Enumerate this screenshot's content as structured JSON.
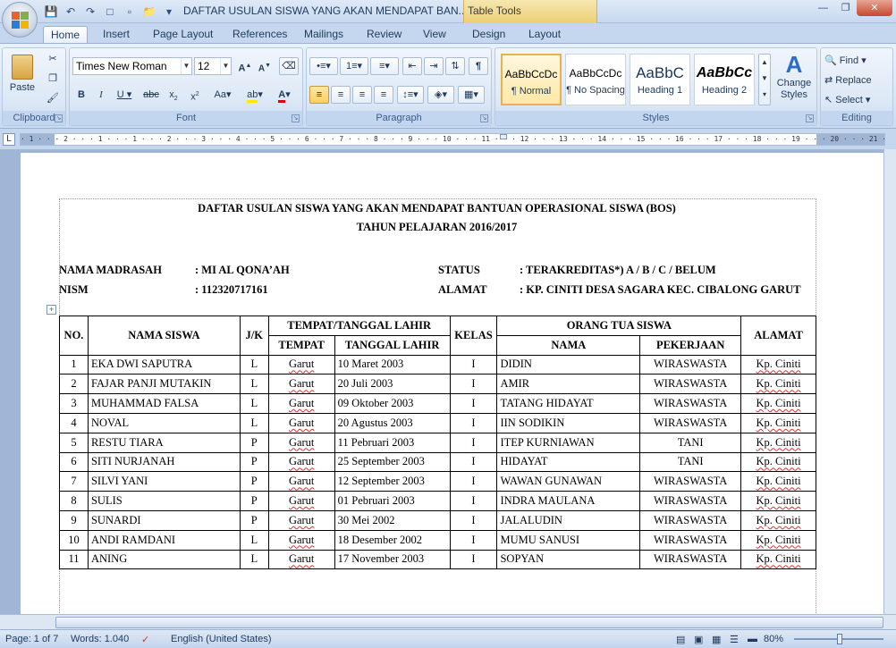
{
  "titlebar": {
    "title": "DAFTAR USULAN SISWA YANG AKAN MENDAPAT BAN...",
    "table_tools": "Table Tools"
  },
  "tabs": [
    "Home",
    "Insert",
    "Page Layout",
    "References",
    "Mailings",
    "Review",
    "View",
    "Design",
    "Layout"
  ],
  "ribbon": {
    "clipboard": {
      "paste": "Paste",
      "label": "Clipboard"
    },
    "font": {
      "name": "Times New Roman",
      "size": "12",
      "label": "Font"
    },
    "paragraph": {
      "label": "Paragraph"
    },
    "styles": {
      "label": "Styles",
      "items": [
        {
          "sample": "AaBbCcDc",
          "name": "¶ Normal"
        },
        {
          "sample": "AaBbCcDc",
          "name": "¶ No Spacing"
        },
        {
          "sample": "AaBbC",
          "name": "Heading 1"
        },
        {
          "sample": "AaBbCc",
          "name": "Heading 2"
        }
      ],
      "change_styles": "Change Styles"
    },
    "editing": {
      "find": "Find",
      "replace": "Replace",
      "select": "Select",
      "label": "Editing"
    }
  },
  "ruler": {
    "ticks": "· 1 · · · 2 · · · 1 · · · 1 · · · 2 · · · 3 · · · 4 · · · 5 · · · 6 · · · 7 · · · 8 · · · 9 · · · 10 · · · 11 · · · 12 · · · 13 · · · 14 · · · 15 · · · 16 · · · 17 · · · 18 · · · 19 · · · 20 · · · 21 · · · 22 · · · 23 · · · 24 · · · 25 · · · 26 · · · 27 · · · 28 · · · 29 · · · 30 ·"
  },
  "document": {
    "heading1": "DAFTAR USULAN SISWA YANG AKAN MENDAPAT BANTUAN OPERASIONAL SISWA (BOS)",
    "heading2": "TAHUN PELAJARAN 2016/2017",
    "info": {
      "nama_madrasah_label": "NAMA MADRASAH",
      "nama_madrasah_value": ": MI AL QONA’AH",
      "nism_label": "NISM",
      "nism_value": ": 112320717161",
      "status_label": "STATUS",
      "status_value": ": TERAKREDITAS*) A / B / C / BELUM",
      "alamat_label": "ALAMAT",
      "alamat_value": ": KP. CINITI DESA SAGARA KEC. CIBALONG GARUT"
    },
    "table": {
      "headers": {
        "no": "NO.",
        "nama": "NAMA SISWA",
        "jk": "J/K",
        "ttl": "TEMPAT/TANGGAL LAHIR",
        "tempat": "TEMPAT",
        "tanggal": "TANGGAL LAHIR",
        "kelas": "KELAS",
        "ortu": "ORANG TUA SISWA",
        "ortu_nama": "NAMA",
        "pekerjaan": "PEKERJAAN",
        "alamat": "ALAMAT"
      },
      "rows": [
        {
          "no": "1",
          "nama": "EKA DWI SAPUTRA",
          "jk": "L",
          "tempat": "Garut",
          "tanggal": "10 Maret 2003",
          "kelas": "I",
          "ortu": "DIDIN",
          "pekerjaan": "WIRASWASTA",
          "alamat": "Kp. Ciniti"
        },
        {
          "no": "2",
          "nama": "FAJAR PANJI MUTAKIN",
          "jk": "L",
          "tempat": "Garut",
          "tanggal": "20 Juli 2003",
          "kelas": "I",
          "ortu": "AMIR",
          "pekerjaan": "WIRASWASTA",
          "alamat": "Kp. Ciniti"
        },
        {
          "no": "3",
          "nama": "MUHAMMAD FALSA",
          "jk": "L",
          "tempat": "Garut",
          "tanggal": "09 Oktober 2003",
          "kelas": "I",
          "ortu": "TATANG HIDAYAT",
          "pekerjaan": "WIRASWASTA",
          "alamat": "Kp. Ciniti"
        },
        {
          "no": "4",
          "nama": "NOVAL",
          "jk": "L",
          "tempat": "Garut",
          "tanggal": "20 Agustus 2003",
          "kelas": "I",
          "ortu": "IIN SODIKIN",
          "pekerjaan": "WIRASWASTA",
          "alamat": "Kp. Ciniti"
        },
        {
          "no": "5",
          "nama": "RESTU TIARA",
          "jk": "P",
          "tempat": "Garut",
          "tanggal": "11 Pebruari 2003",
          "kelas": "I",
          "ortu": "ITEP KURNIAWAN",
          "pekerjaan": "TANI",
          "alamat": "Kp. Ciniti"
        },
        {
          "no": "6",
          "nama": "SITI NURJANAH",
          "jk": "P",
          "tempat": "Garut",
          "tanggal": "25 September 2003",
          "kelas": "I",
          "ortu": "HIDAYAT",
          "pekerjaan": "TANI",
          "alamat": "Kp. Ciniti"
        },
        {
          "no": "7",
          "nama": "SILVI YANI",
          "jk": "P",
          "tempat": "Garut",
          "tanggal": "12 September 2003",
          "kelas": "I",
          "ortu": "WAWAN GUNAWAN",
          "pekerjaan": "WIRASWASTA",
          "alamat": "Kp. Ciniti"
        },
        {
          "no": "8",
          "nama": "SULIS",
          "jk": "P",
          "tempat": "Garut",
          "tanggal": "01 Pebruari 2003",
          "kelas": "I",
          "ortu": "INDRA MAULANA",
          "pekerjaan": "WIRASWASTA",
          "alamat": "Kp. Ciniti"
        },
        {
          "no": "9",
          "nama": "SUNARDI",
          "jk": "P",
          "tempat": "Garut",
          "tanggal": "30 Mei 2002",
          "kelas": "I",
          "ortu": "JALALUDIN",
          "pekerjaan": "WIRASWASTA",
          "alamat": "Kp. Ciniti"
        },
        {
          "no": "10",
          "nama": "ANDI RAMDANI",
          "jk": "L",
          "tempat": "Garut",
          "tanggal": "18 Desember 2002",
          "kelas": "I",
          "ortu": "MUMU SANUSI",
          "pekerjaan": "WIRASWASTA",
          "alamat": "Kp. Ciniti"
        },
        {
          "no": "11",
          "nama": "ANING",
          "jk": "L",
          "tempat": "Garut",
          "tanggal": "17 November 2003",
          "kelas": "I",
          "ortu": "SOPYAN",
          "pekerjaan": "WIRASWASTA",
          "alamat": "Kp. Ciniti"
        }
      ]
    }
  },
  "statusbar": {
    "page": "Page: 1 of 7",
    "words": "Words: 1.040",
    "language": "English (United States)",
    "zoom": "80%"
  }
}
